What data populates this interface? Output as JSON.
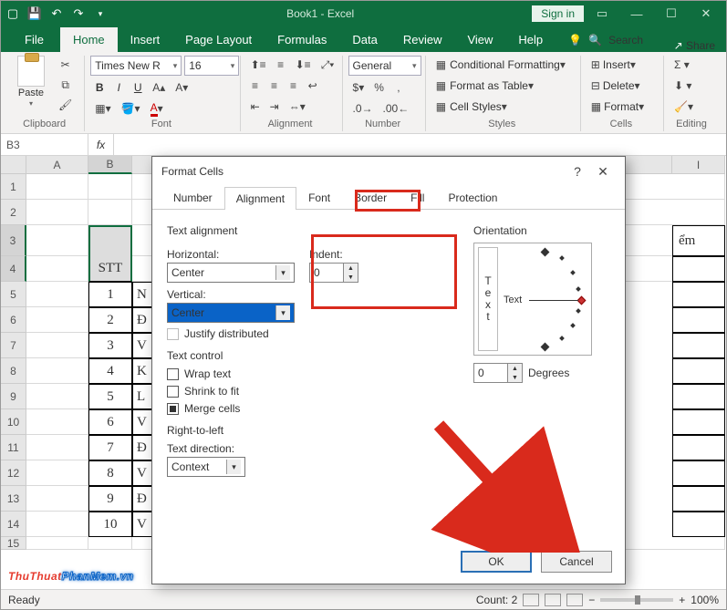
{
  "titlebar": {
    "title": "Book1 - Excel",
    "signin": "Sign in"
  },
  "tabs": {
    "file": "File",
    "items": [
      "Home",
      "Insert",
      "Page Layout",
      "Formulas",
      "Data",
      "Review",
      "View",
      "Help"
    ],
    "tell": "Search",
    "share": "Share",
    "active": "Home"
  },
  "ribbon": {
    "clipboard": {
      "paste": "Paste",
      "label": "Clipboard"
    },
    "font": {
      "name": "Times New R",
      "size": "16",
      "label": "Font"
    },
    "alignment": {
      "label": "Alignment"
    },
    "number": {
      "format": "General",
      "label": "Number"
    },
    "styles": {
      "cond": "Conditional Formatting",
      "table": "Format as Table",
      "cell": "Cell Styles",
      "label": "Styles"
    },
    "cells": {
      "insert": "Insert",
      "delete": "Delete",
      "format": "Format",
      "label": "Cells"
    },
    "editing": {
      "label": "Editing"
    }
  },
  "formula_bar": {
    "namebox": "B3",
    "fx": "fx"
  },
  "columns": [
    "A",
    "B",
    "I"
  ],
  "col_widths": {
    "A": 68,
    "B": 48,
    "I": 58
  },
  "table": {
    "header_b": "STT",
    "header_last": "ểm",
    "rows": [
      {
        "n": "1",
        "t": "N"
      },
      {
        "n": "2",
        "t": "Đ"
      },
      {
        "n": "3",
        "t": "V"
      },
      {
        "n": "4",
        "t": "K"
      },
      {
        "n": "5",
        "t": "L"
      },
      {
        "n": "6",
        "t": "V"
      },
      {
        "n": "7",
        "t": "Đ"
      },
      {
        "n": "8",
        "t": "V"
      },
      {
        "n": "9",
        "t": "Đ"
      },
      {
        "n": "10",
        "t": "V"
      }
    ]
  },
  "dialog": {
    "title": "Format Cells",
    "tabs": [
      "Number",
      "Alignment",
      "Font",
      "Border",
      "Fill",
      "Protection"
    ],
    "active_tab": "Alignment",
    "text_alignment": "Text alignment",
    "horizontal_label": "Horizontal:",
    "horizontal_value": "Center",
    "vertical_label": "Vertical:",
    "vertical_value": "Center",
    "indent_label": "Indent:",
    "indent_value": "0",
    "justify": "Justify distributed",
    "text_control": "Text control",
    "wrap": "Wrap text",
    "shrink": "Shrink to fit",
    "merge": "Merge cells",
    "rtl": "Right-to-left",
    "textdir_label": "Text direction:",
    "textdir_value": "Context",
    "orientation": "Orientation",
    "orient_text": "Text",
    "degrees": "Degrees",
    "degrees_value": "0",
    "ok": "OK",
    "cancel": "Cancel"
  },
  "status": {
    "ready": "Ready",
    "count": "Count: 2",
    "zoom": "100%"
  },
  "watermark": {
    "a": "ThuThuat",
    "b": "PhanMem.vn"
  }
}
